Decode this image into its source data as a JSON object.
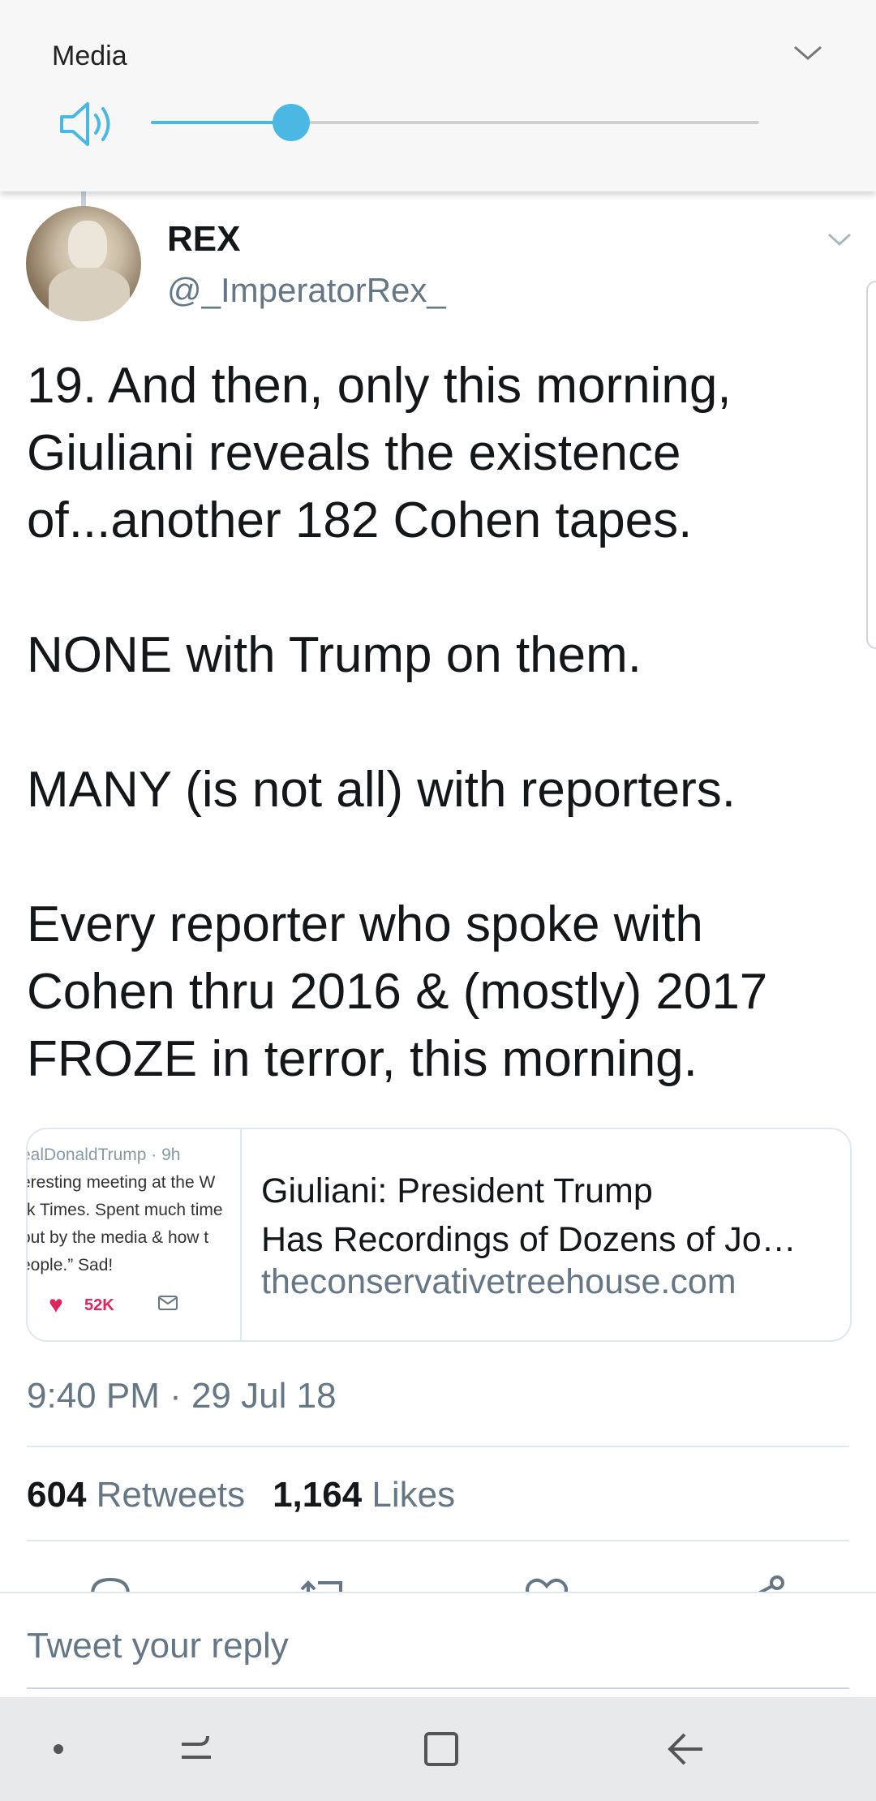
{
  "volume_panel": {
    "title": "Media",
    "level_percent": 23,
    "accent_color": "#4ab8e3",
    "icons": [
      "speaker-icon",
      "chevron-down-icon"
    ]
  },
  "tweet": {
    "display_name": "REX",
    "handle": "@_ImperatorRex_",
    "text": "19. And then, only this morning,\nGiuliani reveals the existence\nof...another 182 Cohen tapes.\n\nNONE with Trump on them.\n\nMANY (is not all) with reporters.\n\nEvery reporter who spoke with\nCohen thru 2016 & (mostly) 2017\nFROZE in terror, this morning.",
    "link_card": {
      "thumbnail_lines": [
        "ealDonaldTrump · 9h",
        "eresting meeting at the W",
        "rk Times. Spent much time",
        "out by the media & how t",
        "eople.” Sad!"
      ],
      "thumbnail_like_count": "52K",
      "title_line1": "Giuliani: President Trump",
      "title_line2": "Has Recordings of Dozens of Jo…",
      "domain": "theconservativetreehouse.com"
    },
    "timestamp": "9:40 PM · 29 Jul 18",
    "retweets_count": "604",
    "retweets_label": "Retweets",
    "likes_count": "1,164",
    "likes_label": "Likes"
  },
  "reply": {
    "placeholder": "Tweet your reply"
  },
  "navigation_bar": {
    "icons": [
      "dot-icon",
      "recent-apps-icon",
      "home-icon",
      "back-icon"
    ],
    "background": "#e8e9eb"
  }
}
